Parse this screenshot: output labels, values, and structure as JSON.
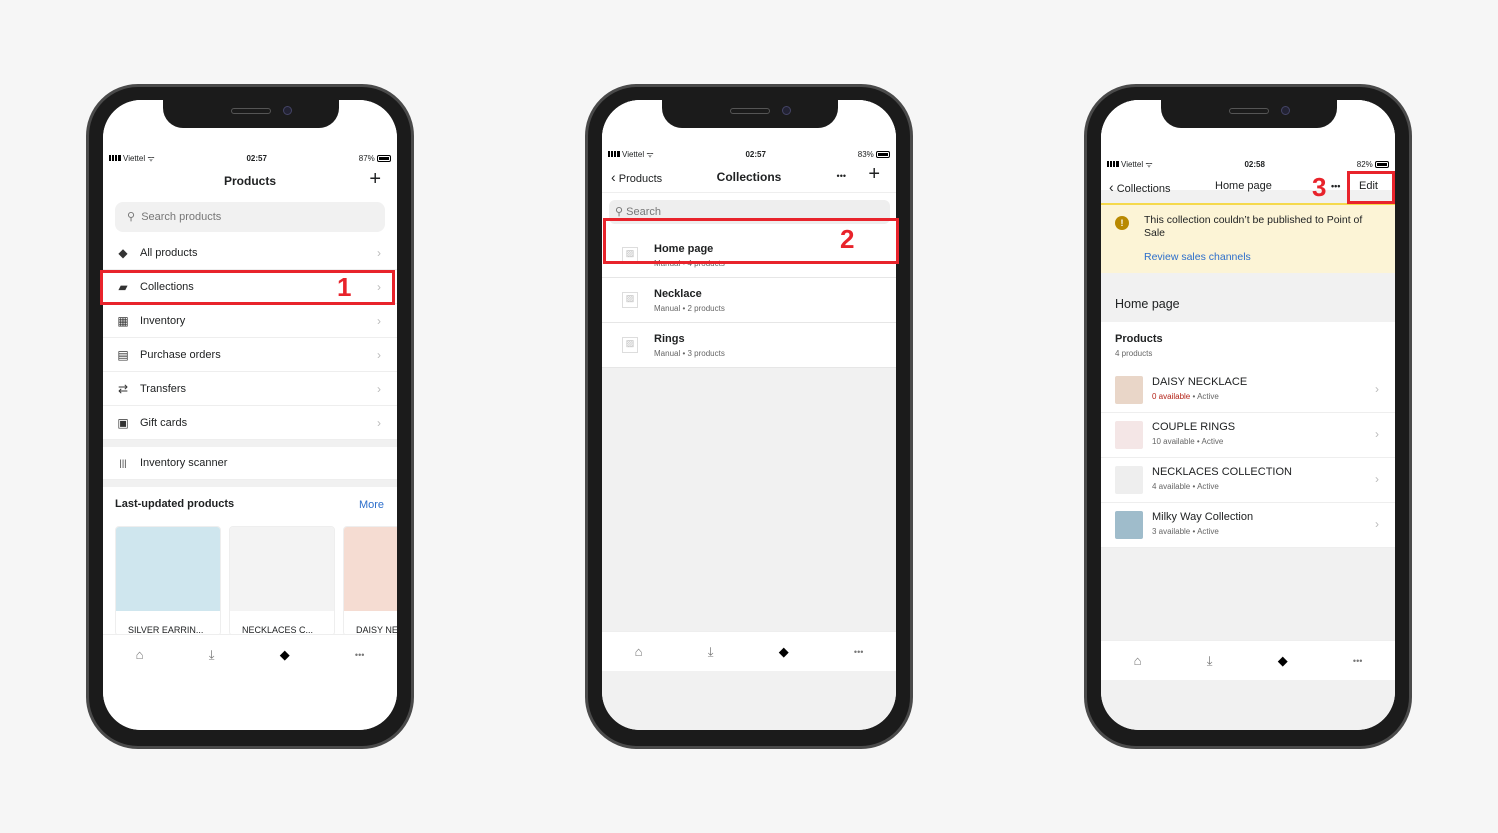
{
  "status": [
    {
      "carrier": "Viettel",
      "time": "02:57",
      "battery": "87%"
    },
    {
      "carrier": "Viettel",
      "time": "02:57",
      "battery": "83%"
    },
    {
      "carrier": "Viettel",
      "time": "02:58",
      "battery": "82%"
    }
  ],
  "tabbar": {
    "icons": [
      "home-icon",
      "inbox-icon",
      "tag-icon",
      "more-icon"
    ],
    "glyphs": [
      "⌂",
      "⤓",
      "◆",
      "•••"
    ]
  },
  "phone1": {
    "title": "Products",
    "add": "+",
    "search_placeholder": "Search products",
    "menu": [
      {
        "label": "All products",
        "icon": "tag-icon",
        "glyph": "◆"
      },
      {
        "label": "Collections",
        "icon": "collections-icon",
        "glyph": "▰"
      },
      {
        "label": "Inventory",
        "icon": "inventory-icon",
        "glyph": "▦"
      },
      {
        "label": "Purchase orders",
        "icon": "purchase-orders-icon",
        "glyph": "▤"
      },
      {
        "label": "Transfers",
        "icon": "transfers-icon",
        "glyph": "⇄"
      },
      {
        "label": "Gift cards",
        "icon": "gift-icon",
        "glyph": "▣"
      }
    ],
    "scanner": {
      "label": "Inventory scanner",
      "glyph": "|||"
    },
    "section_title": "Last-updated products",
    "more": "More",
    "cards": [
      {
        "label": "SILVER EARRIN...",
        "bg": "#cfe6ee"
      },
      {
        "label": "NECKLACES C...",
        "bg": "#f3f3f3"
      },
      {
        "label": "DAISY NE",
        "bg": "#f5dcd2"
      }
    ],
    "step": "1"
  },
  "phone2": {
    "back": "Products",
    "title": "Collections",
    "more": "•••",
    "add": "+",
    "search_placeholder": "Search",
    "collections": [
      {
        "name": "Home page",
        "meta": "Manual • 4 products"
      },
      {
        "name": "Necklace",
        "meta": "Manual • 2 products"
      },
      {
        "name": "Rings",
        "meta": "Manual • 3 products"
      }
    ],
    "step": "2"
  },
  "phone3": {
    "back": "Collections",
    "title": "Home page",
    "more": "•••",
    "edit": "Edit",
    "banner": {
      "message": "This collection couldn’t be published to Point of Sale",
      "link": "Review sales channels"
    },
    "heading": "Home page",
    "products_label": "Products",
    "products_count": "4 products",
    "products": [
      {
        "name": "DAISY NECKLACE",
        "available": "0 available",
        "status": "Active",
        "zero": true,
        "bg": "#e9d6c8"
      },
      {
        "name": "COUPLE RINGS",
        "available": "10 available",
        "status": "Active",
        "zero": false,
        "bg": "#f4e6e6"
      },
      {
        "name": "NECKLACES COLLECTION",
        "available": "4 available",
        "status": "Active",
        "zero": false,
        "bg": "#eeeeee"
      },
      {
        "name": "Milky Way Collection",
        "available": "3 available",
        "status": "Active",
        "zero": false,
        "bg": "#9fbccb"
      }
    ],
    "step": "3"
  },
  "colors": {
    "accent_red": "#e8232b",
    "link_blue": "#2c6ecb",
    "warning_bg": "#fcf4d6",
    "warning_icon": "#b98900",
    "critical": "#b42318"
  }
}
